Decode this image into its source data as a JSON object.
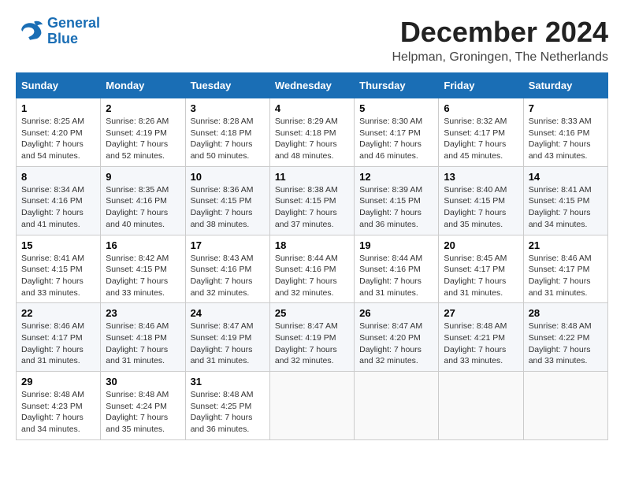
{
  "header": {
    "logo_line1": "General",
    "logo_line2": "Blue",
    "month_title": "December 2024",
    "subtitle": "Helpman, Groningen, The Netherlands"
  },
  "calendar": {
    "days_of_week": [
      "Sunday",
      "Monday",
      "Tuesday",
      "Wednesday",
      "Thursday",
      "Friday",
      "Saturday"
    ],
    "weeks": [
      [
        {
          "day": "1",
          "info": "Sunrise: 8:25 AM\nSunset: 4:20 PM\nDaylight: 7 hours\nand 54 minutes."
        },
        {
          "day": "2",
          "info": "Sunrise: 8:26 AM\nSunset: 4:19 PM\nDaylight: 7 hours\nand 52 minutes."
        },
        {
          "day": "3",
          "info": "Sunrise: 8:28 AM\nSunset: 4:18 PM\nDaylight: 7 hours\nand 50 minutes."
        },
        {
          "day": "4",
          "info": "Sunrise: 8:29 AM\nSunset: 4:18 PM\nDaylight: 7 hours\nand 48 minutes."
        },
        {
          "day": "5",
          "info": "Sunrise: 8:30 AM\nSunset: 4:17 PM\nDaylight: 7 hours\nand 46 minutes."
        },
        {
          "day": "6",
          "info": "Sunrise: 8:32 AM\nSunset: 4:17 PM\nDaylight: 7 hours\nand 45 minutes."
        },
        {
          "day": "7",
          "info": "Sunrise: 8:33 AM\nSunset: 4:16 PM\nDaylight: 7 hours\nand 43 minutes."
        }
      ],
      [
        {
          "day": "8",
          "info": "Sunrise: 8:34 AM\nSunset: 4:16 PM\nDaylight: 7 hours\nand 41 minutes."
        },
        {
          "day": "9",
          "info": "Sunrise: 8:35 AM\nSunset: 4:16 PM\nDaylight: 7 hours\nand 40 minutes."
        },
        {
          "day": "10",
          "info": "Sunrise: 8:36 AM\nSunset: 4:15 PM\nDaylight: 7 hours\nand 38 minutes."
        },
        {
          "day": "11",
          "info": "Sunrise: 8:38 AM\nSunset: 4:15 PM\nDaylight: 7 hours\nand 37 minutes."
        },
        {
          "day": "12",
          "info": "Sunrise: 8:39 AM\nSunset: 4:15 PM\nDaylight: 7 hours\nand 36 minutes."
        },
        {
          "day": "13",
          "info": "Sunrise: 8:40 AM\nSunset: 4:15 PM\nDaylight: 7 hours\nand 35 minutes."
        },
        {
          "day": "14",
          "info": "Sunrise: 8:41 AM\nSunset: 4:15 PM\nDaylight: 7 hours\nand 34 minutes."
        }
      ],
      [
        {
          "day": "15",
          "info": "Sunrise: 8:41 AM\nSunset: 4:15 PM\nDaylight: 7 hours\nand 33 minutes."
        },
        {
          "day": "16",
          "info": "Sunrise: 8:42 AM\nSunset: 4:15 PM\nDaylight: 7 hours\nand 33 minutes."
        },
        {
          "day": "17",
          "info": "Sunrise: 8:43 AM\nSunset: 4:16 PM\nDaylight: 7 hours\nand 32 minutes."
        },
        {
          "day": "18",
          "info": "Sunrise: 8:44 AM\nSunset: 4:16 PM\nDaylight: 7 hours\nand 32 minutes."
        },
        {
          "day": "19",
          "info": "Sunrise: 8:44 AM\nSunset: 4:16 PM\nDaylight: 7 hours\nand 31 minutes."
        },
        {
          "day": "20",
          "info": "Sunrise: 8:45 AM\nSunset: 4:17 PM\nDaylight: 7 hours\nand 31 minutes."
        },
        {
          "day": "21",
          "info": "Sunrise: 8:46 AM\nSunset: 4:17 PM\nDaylight: 7 hours\nand 31 minutes."
        }
      ],
      [
        {
          "day": "22",
          "info": "Sunrise: 8:46 AM\nSunset: 4:17 PM\nDaylight: 7 hours\nand 31 minutes."
        },
        {
          "day": "23",
          "info": "Sunrise: 8:46 AM\nSunset: 4:18 PM\nDaylight: 7 hours\nand 31 minutes."
        },
        {
          "day": "24",
          "info": "Sunrise: 8:47 AM\nSunset: 4:19 PM\nDaylight: 7 hours\nand 31 minutes."
        },
        {
          "day": "25",
          "info": "Sunrise: 8:47 AM\nSunset: 4:19 PM\nDaylight: 7 hours\nand 32 minutes."
        },
        {
          "day": "26",
          "info": "Sunrise: 8:47 AM\nSunset: 4:20 PM\nDaylight: 7 hours\nand 32 minutes."
        },
        {
          "day": "27",
          "info": "Sunrise: 8:48 AM\nSunset: 4:21 PM\nDaylight: 7 hours\nand 33 minutes."
        },
        {
          "day": "28",
          "info": "Sunrise: 8:48 AM\nSunset: 4:22 PM\nDaylight: 7 hours\nand 33 minutes."
        }
      ],
      [
        {
          "day": "29",
          "info": "Sunrise: 8:48 AM\nSunset: 4:23 PM\nDaylight: 7 hours\nand 34 minutes."
        },
        {
          "day": "30",
          "info": "Sunrise: 8:48 AM\nSunset: 4:24 PM\nDaylight: 7 hours\nand 35 minutes."
        },
        {
          "day": "31",
          "info": "Sunrise: 8:48 AM\nSunset: 4:25 PM\nDaylight: 7 hours\nand 36 minutes."
        },
        {
          "day": "",
          "info": ""
        },
        {
          "day": "",
          "info": ""
        },
        {
          "day": "",
          "info": ""
        },
        {
          "day": "",
          "info": ""
        }
      ]
    ]
  }
}
